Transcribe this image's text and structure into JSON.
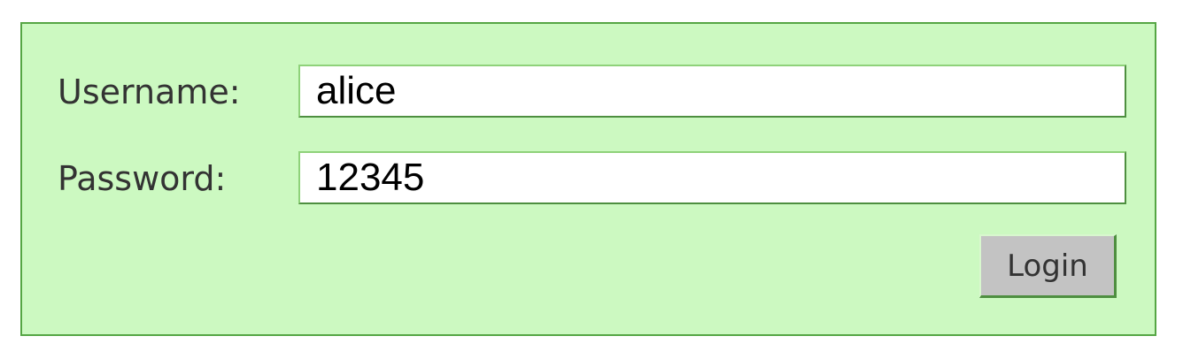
{
  "login_form": {
    "username_label": "Username:",
    "username_value": "alice",
    "password_label": "Password:",
    "password_value": "12345",
    "login_button_label": "Login"
  },
  "colors": {
    "panel_background": "#ccf9c1",
    "panel_border": "#55a644",
    "button_background": "#c3c3c3"
  }
}
